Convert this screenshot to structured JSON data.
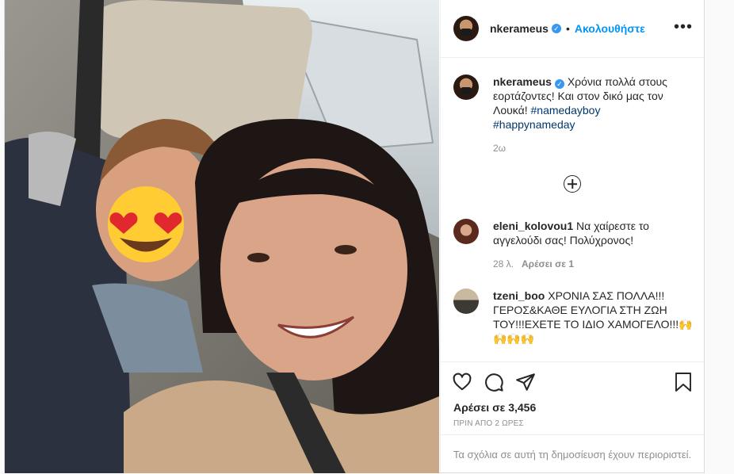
{
  "header": {
    "username": "nkerameus",
    "dot": "•",
    "follow_label": "Ακολουθήστε",
    "more_label": "•••"
  },
  "caption": {
    "username": "nkerameus",
    "text": "Χρόνια πολλά στους εορτάζοντες! Και στον δικό μας τον Λουκά! ",
    "hashtags": [
      "#namedayboy",
      "#happynameday"
    ],
    "time": "2ω"
  },
  "comments": [
    {
      "username": "eleni_kolovou1",
      "text": "Να χαίρεστε το αγγελούδι σας! Πολύχρονος!",
      "time": "28 λ.",
      "likes": "Αρέσει σε 1"
    },
    {
      "username": "tzeni_boo",
      "text": "ΧΡΟΝΙΑ ΣΑΣ ΠΟΛΛΑ!!! ΓΕΡΟΣ&ΚΑΘΕ ΕΥΛΟΓΙΑ ΣΤΗ ΖΩΗ ΤΟΥ!!!ΕΧΕΤΕ ΤΟ ΙΔΙΟ ΧΑΜΟΓΕΛΟ!!!",
      "emoji": "🙌",
      "emoji_row": "🙌🙌🙌"
    }
  ],
  "actions": {
    "likes_count": "Αρέσει σε 3,456",
    "posted": "ΠΡΙΝ ΑΠΟ 2 ΩΡΕΣ"
  },
  "restricted_text": "Τα σχόλια σε αυτή τη δημοσίευση έχουν περιοριστεί.",
  "icons": {
    "verified": "verified-badge-icon",
    "add": "plus-circle-icon",
    "like": "heart-icon",
    "comment": "comment-bubble-icon",
    "share": "paper-plane-icon",
    "save": "bookmark-icon"
  },
  "colors": {
    "link_blue": "#0095f6",
    "hashtag": "#00376b",
    "muted": "#8e8e8e",
    "verified": "#3897f0"
  }
}
